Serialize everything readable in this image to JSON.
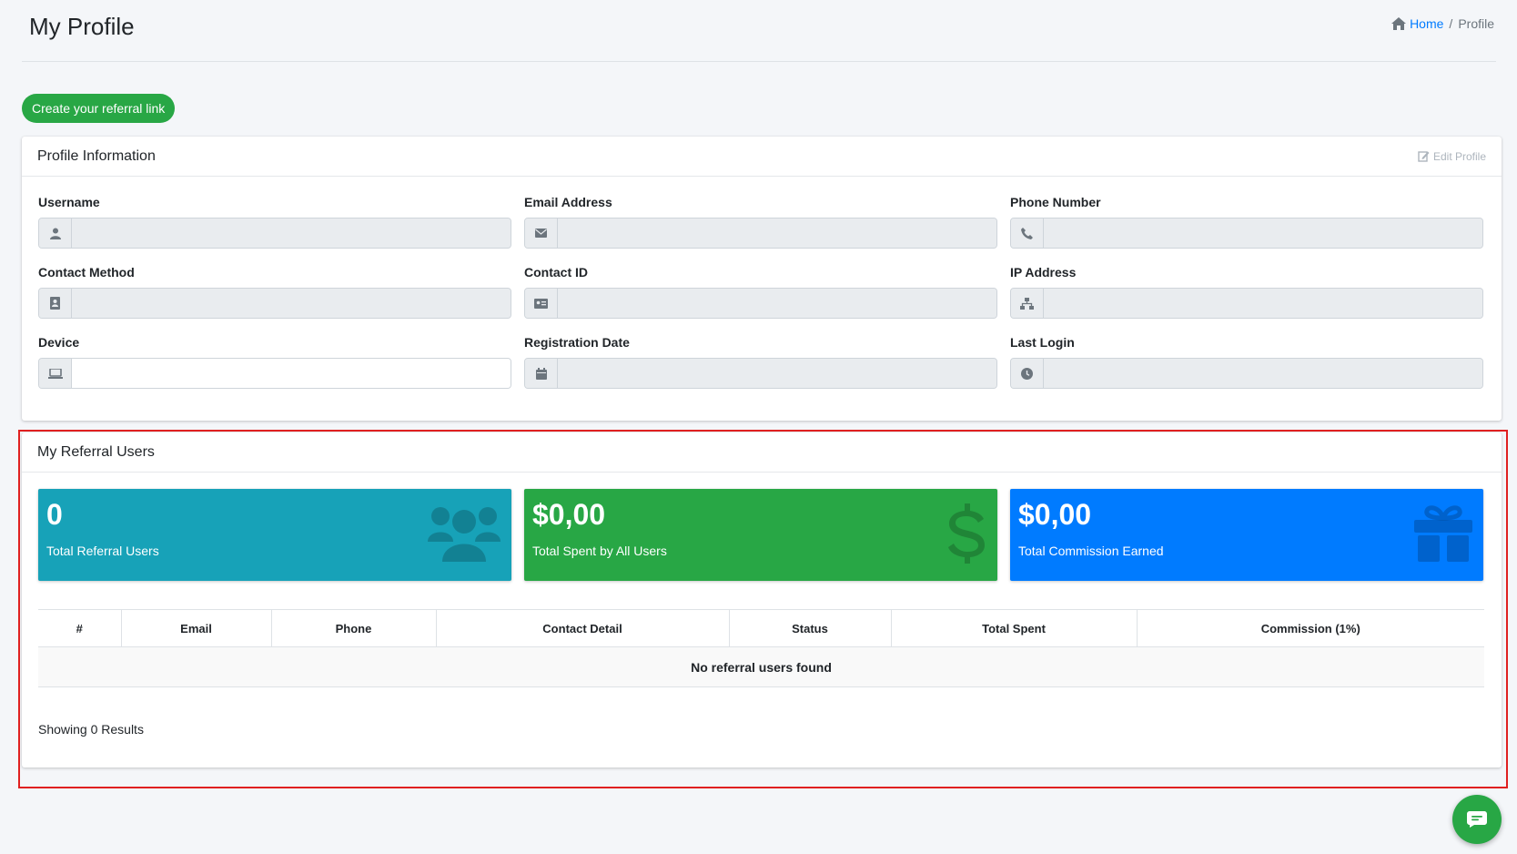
{
  "header": {
    "title": "My Profile",
    "breadcrumb": {
      "home": "Home",
      "separator": "/",
      "current": "Profile"
    }
  },
  "referral_button": "Create your referral link",
  "profile_card": {
    "title": "Profile Information",
    "edit_label": "Edit Profile",
    "fields": [
      {
        "label": "Username",
        "icon": "user-icon",
        "value": ""
      },
      {
        "label": "Email Address",
        "icon": "envelope-icon",
        "value": ""
      },
      {
        "label": "Phone Number",
        "icon": "phone-icon",
        "value": ""
      },
      {
        "label": "Contact Method",
        "icon": "address-book-icon",
        "value": ""
      },
      {
        "label": "Contact ID",
        "icon": "id-card-icon",
        "value": ""
      },
      {
        "label": "IP Address",
        "icon": "network-icon",
        "value": ""
      },
      {
        "label": "Device",
        "icon": "laptop-icon",
        "value": ""
      },
      {
        "label": "Registration Date",
        "icon": "calendar-icon",
        "value": ""
      },
      {
        "label": "Last Login",
        "icon": "clock-icon",
        "value": ""
      }
    ]
  },
  "referral_card": {
    "title": "My Referral Users",
    "stats": [
      {
        "value": "0",
        "label": "Total Referral Users",
        "icon": "users-icon",
        "color": "#17a2b8"
      },
      {
        "value": "$0,00",
        "label": "Total Spent by All Users",
        "icon": "dollar-icon",
        "color": "#28a745"
      },
      {
        "value": "$0,00",
        "label": "Total Commission Earned",
        "icon": "gift-icon",
        "color": "#007bff"
      }
    ],
    "table": {
      "columns": [
        "#",
        "Email",
        "Phone",
        "Contact Detail",
        "Status",
        "Total Spent",
        "Commission (1%)"
      ],
      "empty_message": "No referral users found"
    },
    "showing": "Showing 0 Results"
  },
  "colors": {
    "success": "#28a745",
    "info": "#17a2b8",
    "primary": "#007bff",
    "highlight": "#e02020"
  }
}
